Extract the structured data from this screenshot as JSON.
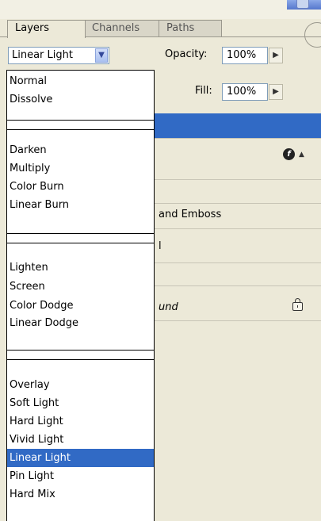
{
  "panel": {
    "tabs": [
      "Layers",
      "Channels",
      "Paths"
    ],
    "active_tab": "Layers"
  },
  "blend_mode": {
    "value": "Linear Light",
    "options": [
      "Normal",
      "Dissolve",
      "Darken",
      "Multiply",
      "Color Burn",
      "Linear Burn",
      "Lighten",
      "Screen",
      "Color Dodge",
      "Linear Dodge",
      "Overlay",
      "Soft Light",
      "Hard Light",
      "Vivid Light",
      "Linear Light",
      "Pin Light",
      "Hard Mix"
    ]
  },
  "opacity": {
    "label": "Opacity:",
    "value": "100%"
  },
  "fill": {
    "label": "Fill:",
    "value": "100%"
  },
  "layers_behind": {
    "effect_label": "and Emboss",
    "partial_row": "l",
    "background_fragment": "und"
  },
  "icons": {
    "dropdown": "chevron-down-icon",
    "arrow": "triangle-right-icon",
    "effects": "fx-icon",
    "lock": "lock-icon",
    "scroll_up": "scroll-up-arrow-icon"
  },
  "colors": {
    "panel_bg": "#ece9d8",
    "selection": "#316ac5",
    "field_border": "#7f9db9"
  }
}
